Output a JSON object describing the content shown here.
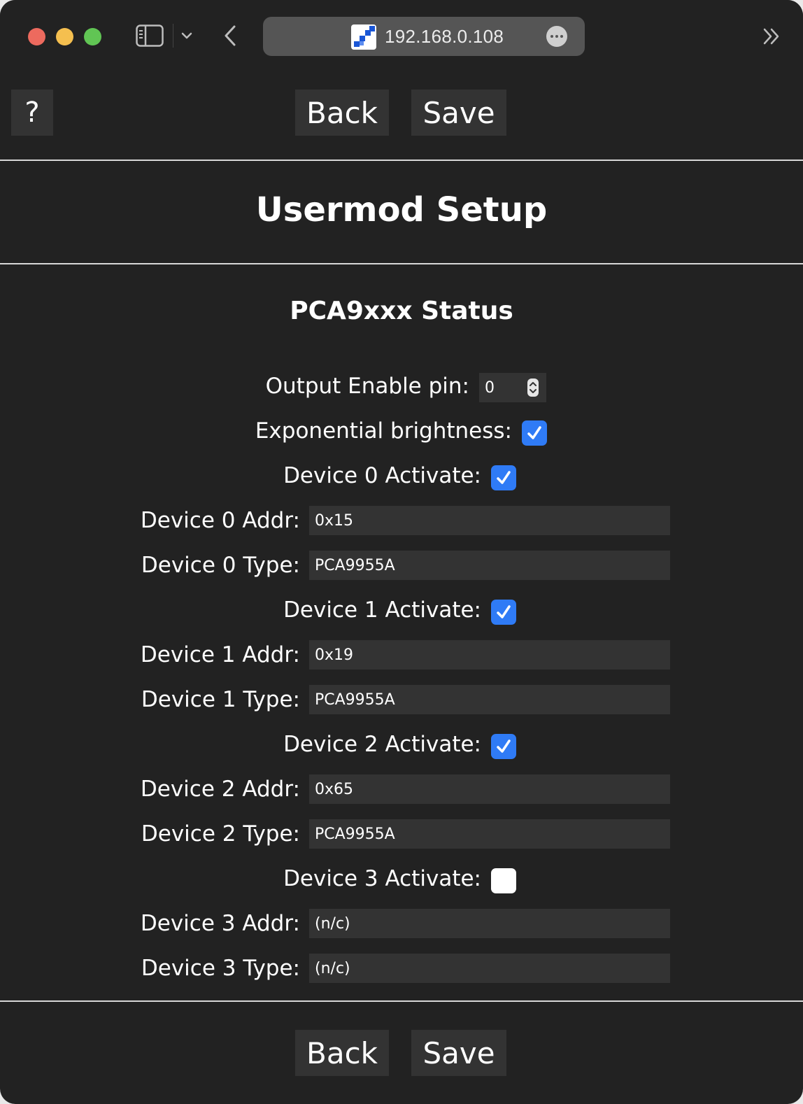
{
  "browser": {
    "url": "192.168.0.108",
    "colors": {
      "close": "#ed6a5e",
      "minimize": "#f5bf4f",
      "zoom": "#61c554"
    }
  },
  "toolbar": {
    "help_label": "?",
    "back_label": "Back",
    "save_label": "Save"
  },
  "page": {
    "title": "Usermod Setup",
    "section_title": "PCA9xxx Status"
  },
  "settings": {
    "output_enable_label": "Output Enable pin:",
    "output_enable_value": "0",
    "exp_brightness_label": "Exponential brightness:",
    "exp_brightness_checked": true,
    "devices": [
      {
        "activate_label": "Device 0 Activate:",
        "active": true,
        "addr_label": "Device 0 Addr:",
        "addr": "0x15",
        "type_label": "Device 0 Type:",
        "type": "PCA9955A"
      },
      {
        "activate_label": "Device 1 Activate:",
        "active": true,
        "addr_label": "Device 1 Addr:",
        "addr": "0x19",
        "type_label": "Device 1 Type:",
        "type": "PCA9955A"
      },
      {
        "activate_label": "Device 2 Activate:",
        "active": true,
        "addr_label": "Device 2 Addr:",
        "addr": "0x65",
        "type_label": "Device 2 Type:",
        "type": "PCA9955A"
      },
      {
        "activate_label": "Device 3 Activate:",
        "active": false,
        "addr_label": "Device 3 Addr:",
        "addr": "(n/c)",
        "type_label": "Device 3 Type:",
        "type": "(n/c)"
      }
    ]
  },
  "footer": {
    "back_label": "Back",
    "save_label": "Save"
  },
  "colors": {
    "background": "#222222",
    "button": "#333333",
    "checkbox_checked": "#2f7bf6",
    "text": "#ffffff"
  }
}
